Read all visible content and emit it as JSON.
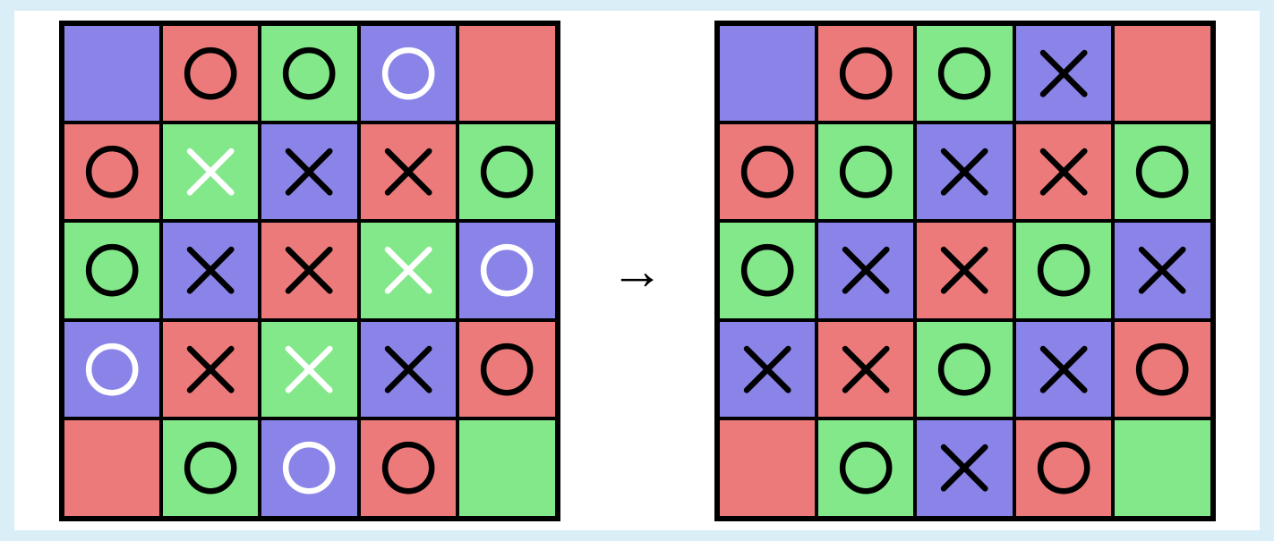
{
  "arrow_label": "→",
  "colors": {
    "red": "#ec7a7a",
    "green": "#82e88a",
    "blue": "#8a84e8"
  },
  "mark_colors": {
    "black": "#000000",
    "white": "#ffffff"
  },
  "grids": {
    "left": [
      [
        {
          "bg": "blue",
          "mark": null
        },
        {
          "bg": "red",
          "mark": "O",
          "mc": "black"
        },
        {
          "bg": "green",
          "mark": "O",
          "mc": "black"
        },
        {
          "bg": "blue",
          "mark": "O",
          "mc": "white"
        },
        {
          "bg": "red",
          "mark": null
        }
      ],
      [
        {
          "bg": "red",
          "mark": "O",
          "mc": "black"
        },
        {
          "bg": "green",
          "mark": "X",
          "mc": "white"
        },
        {
          "bg": "blue",
          "mark": "X",
          "mc": "black"
        },
        {
          "bg": "red",
          "mark": "X",
          "mc": "black"
        },
        {
          "bg": "green",
          "mark": "O",
          "mc": "black"
        }
      ],
      [
        {
          "bg": "green",
          "mark": "O",
          "mc": "black"
        },
        {
          "bg": "blue",
          "mark": "X",
          "mc": "black"
        },
        {
          "bg": "red",
          "mark": "X",
          "mc": "black"
        },
        {
          "bg": "green",
          "mark": "X",
          "mc": "white"
        },
        {
          "bg": "blue",
          "mark": "O",
          "mc": "white"
        }
      ],
      [
        {
          "bg": "blue",
          "mark": "O",
          "mc": "white"
        },
        {
          "bg": "red",
          "mark": "X",
          "mc": "black"
        },
        {
          "bg": "green",
          "mark": "X",
          "mc": "white"
        },
        {
          "bg": "blue",
          "mark": "X",
          "mc": "black"
        },
        {
          "bg": "red",
          "mark": "O",
          "mc": "black"
        }
      ],
      [
        {
          "bg": "red",
          "mark": null
        },
        {
          "bg": "green",
          "mark": "O",
          "mc": "black"
        },
        {
          "bg": "blue",
          "mark": "O",
          "mc": "white"
        },
        {
          "bg": "red",
          "mark": "O",
          "mc": "black"
        },
        {
          "bg": "green",
          "mark": null
        }
      ]
    ],
    "right": [
      [
        {
          "bg": "blue",
          "mark": null
        },
        {
          "bg": "red",
          "mark": "O",
          "mc": "black"
        },
        {
          "bg": "green",
          "mark": "O",
          "mc": "black"
        },
        {
          "bg": "blue",
          "mark": "X",
          "mc": "black"
        },
        {
          "bg": "red",
          "mark": null
        }
      ],
      [
        {
          "bg": "red",
          "mark": "O",
          "mc": "black"
        },
        {
          "bg": "green",
          "mark": "O",
          "mc": "black"
        },
        {
          "bg": "blue",
          "mark": "X",
          "mc": "black"
        },
        {
          "bg": "red",
          "mark": "X",
          "mc": "black"
        },
        {
          "bg": "green",
          "mark": "O",
          "mc": "black"
        }
      ],
      [
        {
          "bg": "green",
          "mark": "O",
          "mc": "black"
        },
        {
          "bg": "blue",
          "mark": "X",
          "mc": "black"
        },
        {
          "bg": "red",
          "mark": "X",
          "mc": "black"
        },
        {
          "bg": "green",
          "mark": "O",
          "mc": "black"
        },
        {
          "bg": "blue",
          "mark": "X",
          "mc": "black"
        }
      ],
      [
        {
          "bg": "blue",
          "mark": "X",
          "mc": "black"
        },
        {
          "bg": "red",
          "mark": "X",
          "mc": "black"
        },
        {
          "bg": "green",
          "mark": "O",
          "mc": "black"
        },
        {
          "bg": "blue",
          "mark": "X",
          "mc": "black"
        },
        {
          "bg": "red",
          "mark": "O",
          "mc": "black"
        }
      ],
      [
        {
          "bg": "red",
          "mark": null
        },
        {
          "bg": "green",
          "mark": "O",
          "mc": "black"
        },
        {
          "bg": "blue",
          "mark": "X",
          "mc": "black"
        },
        {
          "bg": "red",
          "mark": "O",
          "mc": "black"
        },
        {
          "bg": "green",
          "mark": null
        }
      ]
    ]
  }
}
